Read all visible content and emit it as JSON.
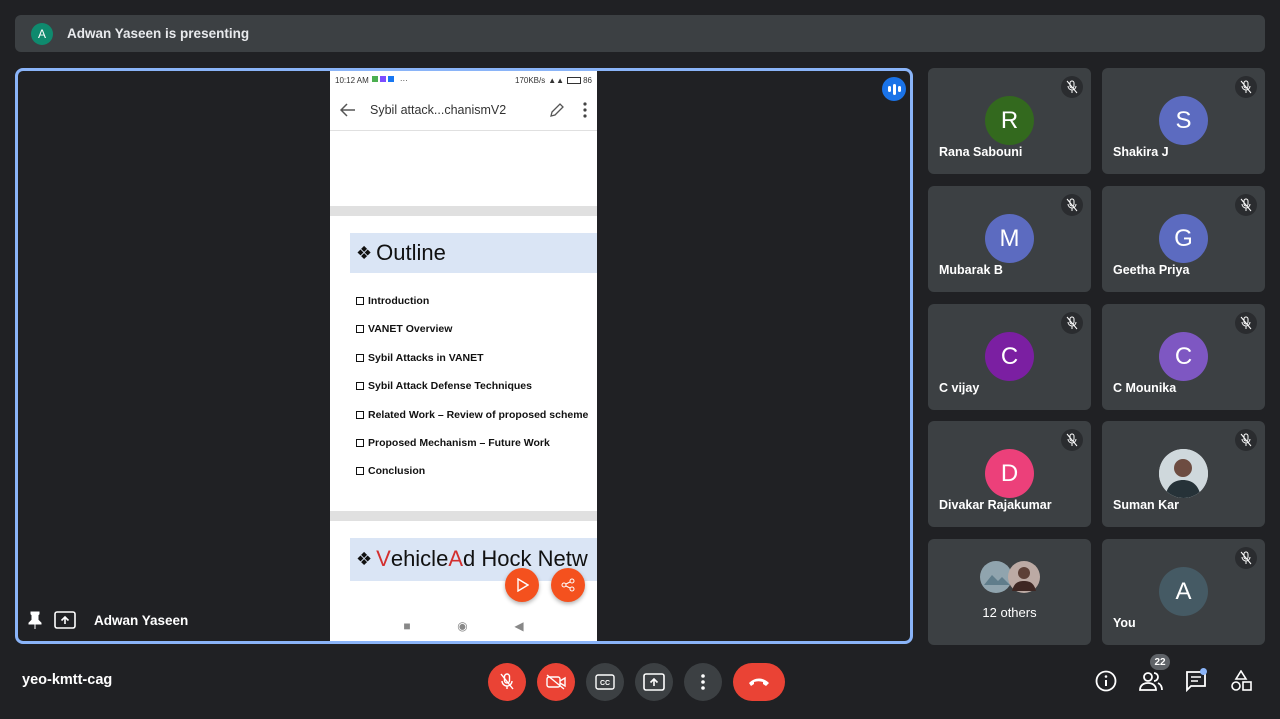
{
  "banner": {
    "avatar_letter": "A",
    "text": "Adwan Yaseen is presenting"
  },
  "presenter": {
    "name": "Adwan Yaseen"
  },
  "phone": {
    "status_time": "10:12 AM",
    "status_right": "170KB/s",
    "battery": "86",
    "doc_title": "Sybil attack...chanismV2",
    "outline_title": "Outline",
    "outline_items": [
      "Introduction",
      "VANET Overview",
      "Sybil Attacks in VANET",
      "Sybil Attack Defense Techniques",
      "Related Work – Review of proposed scheme",
      "Proposed Mechanism – Future Work",
      "Conclusion"
    ],
    "next_heading": {
      "v": "V",
      "part1": "ehicle ",
      "a": "A",
      "part2": "d H",
      "rest": "ock Netw"
    }
  },
  "participants": [
    {
      "name": "Rana Sabouni",
      "initial": "R",
      "color": "#33691e"
    },
    {
      "name": "Shakira J",
      "initial": "S",
      "color": "#5c6bc0"
    },
    {
      "name": "Mubarak B",
      "initial": "M",
      "color": "#5c6bc0"
    },
    {
      "name": "Geetha Priya",
      "initial": "G",
      "color": "#5c6bc0"
    },
    {
      "name": "C vijay",
      "initial": "C",
      "color": "#7b1fa2"
    },
    {
      "name": "C Mounika",
      "initial": "C",
      "color": "#7e57c2"
    },
    {
      "name": "Divakar Rajakumar",
      "initial": "D",
      "color": "#ec407a"
    },
    {
      "name": "Suman Kar",
      "initial": "",
      "color": "#795548"
    }
  ],
  "others": {
    "label": "12 others"
  },
  "you": {
    "name": "You",
    "initial": "A",
    "color": "#455a64"
  },
  "meeting": {
    "code": "yeo-kmtt-cag",
    "participant_count": "22"
  }
}
